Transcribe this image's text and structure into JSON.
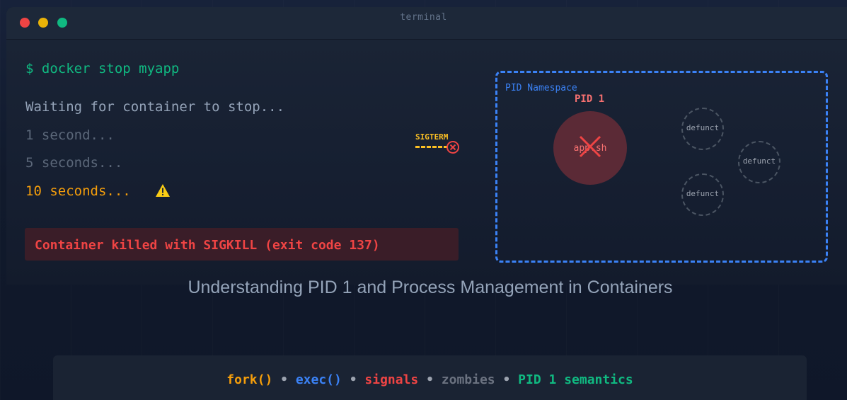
{
  "terminal": {
    "title": "terminal",
    "command": "$ docker stop myapp",
    "waiting": "Waiting for container to stop...",
    "count_1": "1 second...",
    "count_5": "5 seconds...",
    "count_10": "10 seconds...",
    "killed": "Container killed with SIGKILL (exit code 137)"
  },
  "diagram": {
    "signal_label": "SIGTERM",
    "namespace_label": "PID Namespace",
    "pid_label": "PID 1",
    "process_name": "app.sh",
    "zombies": [
      "defunct",
      "defunct",
      "defunct"
    ]
  },
  "subtitle": "Understanding PID 1 and Process Management in Containers",
  "footer": {
    "items": [
      "fork()",
      "exec()",
      "signals",
      "zombies",
      "PID 1 semantics"
    ],
    "separator": "•"
  },
  "colors": {
    "green": "#10b981",
    "amber": "#f59e0b",
    "red": "#ef4444",
    "blue": "#3b82f6",
    "gray": "#6b7280"
  },
  "icons": {
    "warning": "warning-icon",
    "kill": "close-icon",
    "window_controls": [
      "close-dot",
      "minimize-dot",
      "maximize-dot"
    ]
  }
}
